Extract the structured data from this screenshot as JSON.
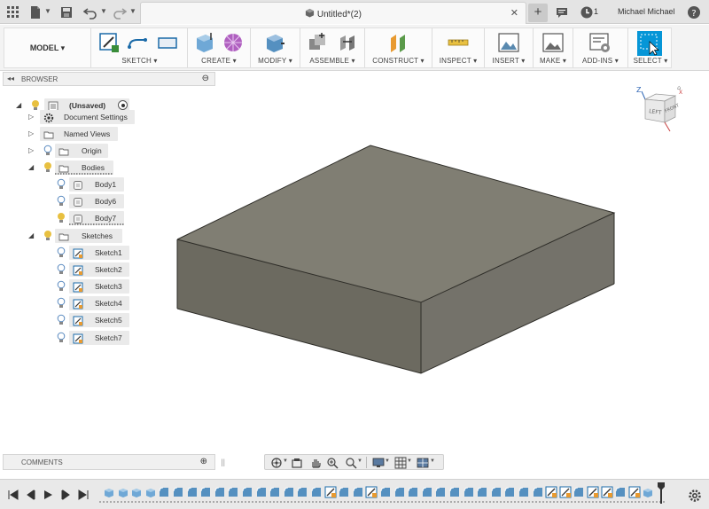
{
  "titlebar": {
    "document_title": "Untitled*(2)",
    "job_count": "1",
    "user_name": "Michael Michael"
  },
  "ribbon": {
    "workspace": "MODEL",
    "groups": [
      {
        "label": "SKETCH"
      },
      {
        "label": "CREATE"
      },
      {
        "label": "MODIFY"
      },
      {
        "label": "ASSEMBLE"
      },
      {
        "label": "CONSTRUCT"
      },
      {
        "label": "INSPECT"
      },
      {
        "label": "INSERT"
      },
      {
        "label": "MAKE"
      },
      {
        "label": "ADD-INS"
      },
      {
        "label": "SELECT"
      }
    ]
  },
  "browser": {
    "title": "BROWSER",
    "root": "(Unsaved)",
    "items": [
      {
        "label": "Document Settings"
      },
      {
        "label": "Named Views"
      },
      {
        "label": "Origin"
      },
      {
        "label": "Bodies"
      },
      {
        "label": "Body1"
      },
      {
        "label": "Body6"
      },
      {
        "label": "Body7"
      },
      {
        "label": "Sketches"
      },
      {
        "label": "Sketch1"
      },
      {
        "label": "Sketch2"
      },
      {
        "label": "Sketch3"
      },
      {
        "label": "Sketch4"
      },
      {
        "label": "Sketch5"
      },
      {
        "label": "Sketch7"
      }
    ]
  },
  "comments": {
    "title": "COMMENTS"
  },
  "viewcube": {
    "left": "LEFT",
    "front": "FRONT",
    "axis_z": "Z",
    "axis_x": "X"
  },
  "colors": {
    "accent": "#0696d7",
    "body_top": "#807e73",
    "body_front": "#6c6a60",
    "body_side": "#74726a"
  }
}
